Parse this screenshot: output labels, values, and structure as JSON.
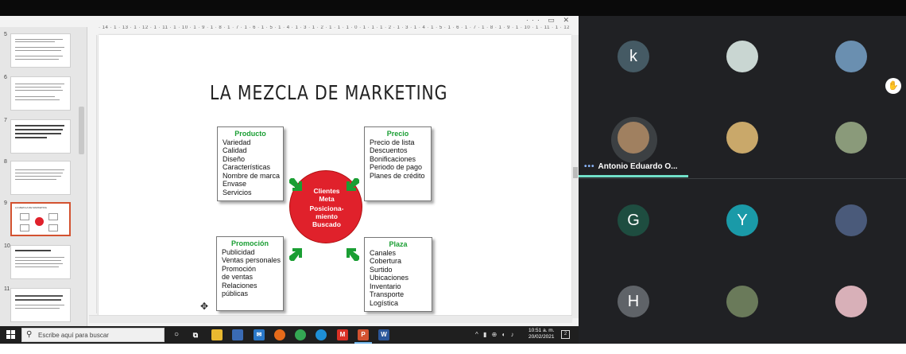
{
  "slide": {
    "title": "LA MEZCLA DE MARKETING",
    "producto": {
      "heading": "Producto",
      "items": [
        "Variedad",
        "Calidad",
        "Diseño",
        "Características",
        "Nombre de marca",
        "Envase",
        "Servicios"
      ]
    },
    "precio": {
      "heading": "Precio",
      "items": [
        "Precio de lista",
        "Descuentos",
        "Bonificaciones",
        "Periodo de pago",
        "Planes de crédito"
      ]
    },
    "promocion": {
      "heading": "Promoción",
      "items": [
        "Publicidad",
        "Ventas personales",
        "Promoción",
        "de ventas",
        "Relaciones",
        "públicas"
      ]
    },
    "plaza": {
      "heading": "Plaza",
      "items": [
        "Canales",
        "Cobertura",
        "Surtido",
        "Ubicaciones",
        "Inventario",
        "Transporte",
        "Logística"
      ]
    },
    "center": {
      "line1": "Clientes",
      "line2": "Meta",
      "line3": "Posiciona-",
      "line4": "miento",
      "line5": "Buscado"
    },
    "arrow_color": "#1a9e33",
    "circle_color": "#e0212b"
  },
  "thumbnails": [
    {
      "num": "5"
    },
    {
      "num": "6"
    },
    {
      "num": "7"
    },
    {
      "num": "8"
    },
    {
      "num": "9",
      "selected": true
    },
    {
      "num": "10"
    },
    {
      "num": "11"
    }
  ],
  "ruler": "· 14 · 1 · 13 · 1 · 12 · 1 · 11 · 1 · 10 · 1 · 9 · 1 · 8 · 1 · 7 · 1 · 6 · 1 · 5 · 1 · 4 · 1 · 3 · 1 · 2 · 1 · 1 · 1 · 0 · 1 · 1 · 1 · 2 · 1 · 3 · 1 · 4 · 1 · 5 · 1 · 6 · 1 · 7 · 1 · 8 · 1 · 9 · 1 · 10 · 1 · 11 · 1 · 12 · 1 · 13 · 1 · 14",
  "taskbar": {
    "search_placeholder": "Escribe aquí para buscar",
    "time": "10:51 a. m.",
    "date": "20/02/2021",
    "notif_count": "2"
  },
  "participants": [
    {
      "initial": "k",
      "color": "#455a64"
    },
    {
      "initial": "",
      "color": "#c9d6d2"
    },
    {
      "initial": "",
      "color": "#6a8fb0"
    },
    {
      "initial": "",
      "color": "#a08060",
      "name": "Antonio Eduardo O...",
      "active": true
    },
    {
      "initial": "",
      "color": "#c9a86a"
    },
    {
      "initial": "",
      "color": "#8a9a7a"
    },
    {
      "initial": "G",
      "color": "#1e4d40"
    },
    {
      "initial": "Y",
      "color": "#1a9aa8"
    },
    {
      "initial": "",
      "color": "#4a5a7a"
    },
    {
      "initial": "H",
      "color": "#5f6368"
    },
    {
      "initial": "",
      "color": "#6a7a5a"
    },
    {
      "initial": "",
      "color": "#d8b0b8"
    }
  ]
}
